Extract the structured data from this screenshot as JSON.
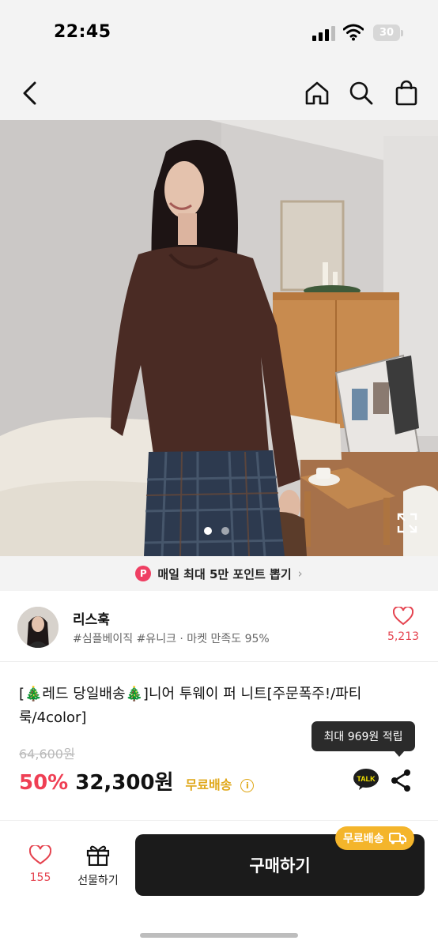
{
  "status_bar": {
    "time": "22:45",
    "battery": "30"
  },
  "nav": {
    "back_icon": "chevron-left-icon",
    "home_icon": "home-icon",
    "search_icon": "search-icon",
    "cart_icon": "shopping-bag-icon"
  },
  "hero": {
    "slide_count": 2,
    "active_slide": 1
  },
  "promo": {
    "badge": "P",
    "text": "매일 최대 5만 포인트 뽑기",
    "arrow": "›"
  },
  "seller": {
    "name": "리스훅",
    "tags": "#심플베이직 #유니크 · 마켓 만족도 95%",
    "like_count": "5,213"
  },
  "product": {
    "title": "[🎄레드 당일배송🎄]니어 투웨이 퍼 니트[주문폭주!/파티룩/4color]",
    "original_price": "64,600원",
    "discount": "50%",
    "price": "32,300원",
    "shipping": "무료배송",
    "tooltip": "최대 969원 적립",
    "talk_label": "TALK"
  },
  "bottom": {
    "like_count": "155",
    "gift_label": "선물하기",
    "buy_label": "구매하기",
    "free_shipping_badge": "무료배송"
  },
  "colors": {
    "accent_red": "#ef3f54",
    "shipping_yellow": "#e0a81a",
    "buy_button": "#1b1b1b",
    "badge_yellow": "#f4b52b"
  }
}
